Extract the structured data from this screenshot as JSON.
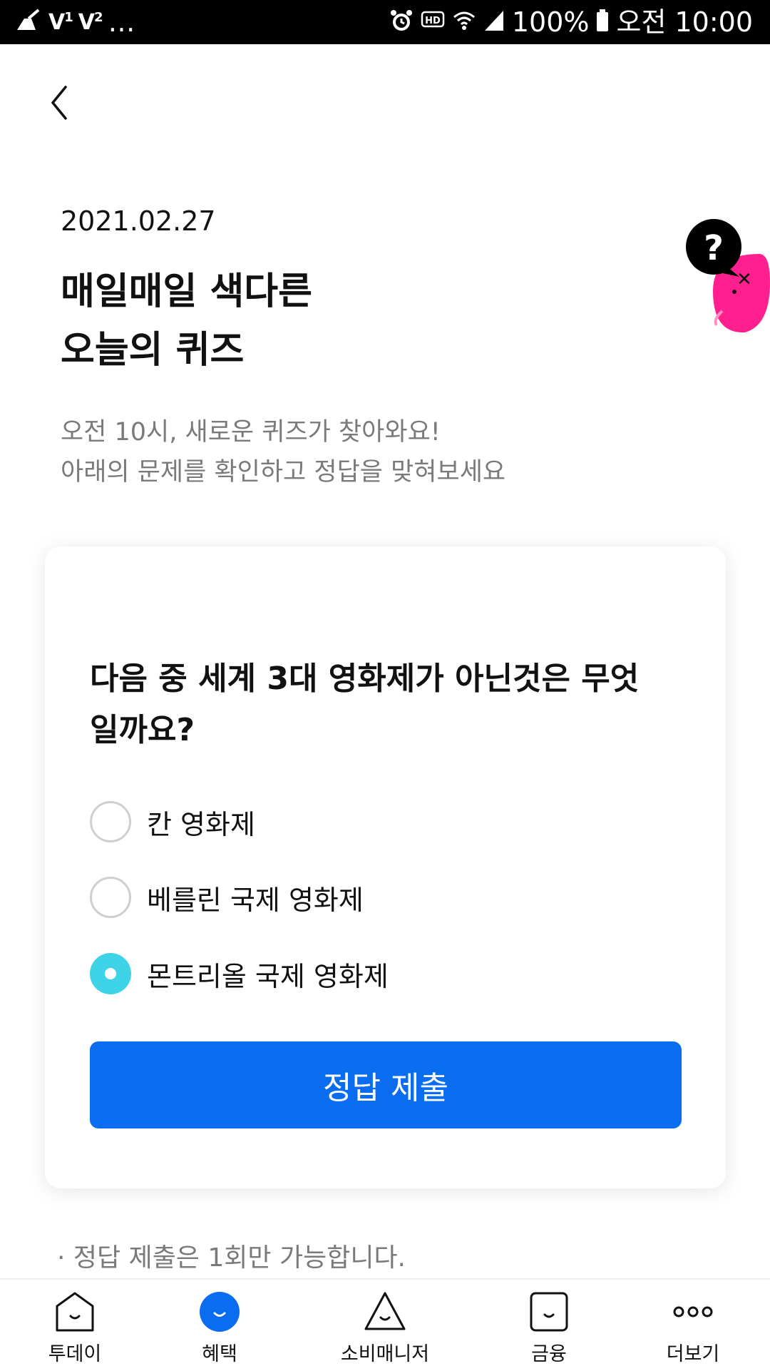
{
  "status_bar": {
    "left_text": "…",
    "battery": "100%",
    "time": "오전 10:00",
    "icons": [
      "broom-icon",
      "volte1-icon",
      "volte2-icon",
      "alarm-icon",
      "hd-icon",
      "wifi-icon",
      "signal-icon",
      "battery-icon"
    ]
  },
  "header": {
    "back_icon": "chevron-left-icon"
  },
  "date": "2021.02.27",
  "title": {
    "line1": "매일매일 색다른",
    "line2": "오늘의 퀴즈"
  },
  "description": {
    "line1": "오전 10시, 새로운 퀴즈가 찾아와요!",
    "line2": "아래의 문제를 확인하고 정답을 맞혀보세요"
  },
  "mascot": {
    "bubble_text": "?",
    "icon": "quiz-mascot-icon"
  },
  "quiz": {
    "question_line1": "다음 중 세계 3대 영화제가 아닌것은 무엇",
    "question_line2": "일까요?",
    "options": [
      {
        "label": "칸 영화제",
        "selected": false
      },
      {
        "label": "베를린 국제 영화제",
        "selected": false
      },
      {
        "label": "몬트리올 국제 영화제",
        "selected": true
      }
    ],
    "submit_label": "정답 제출"
  },
  "notice": "· 정답 제출은 1회만 가능합니다.",
  "bottom_nav": {
    "items": [
      {
        "label": "투데이",
        "icon": "today-icon",
        "active": false
      },
      {
        "label": "혜택",
        "icon": "benefit-icon",
        "active": true
      },
      {
        "label": "소비매니저",
        "icon": "spending-manager-icon",
        "active": false
      },
      {
        "label": "금융",
        "icon": "finance-icon",
        "active": false
      },
      {
        "label": "더보기",
        "icon": "more-icon",
        "active": false
      }
    ]
  },
  "colors": {
    "primary": "#0a6df0",
    "radio_selected": "#3ed3e6",
    "mascot_pink": "#ff1f8e"
  }
}
